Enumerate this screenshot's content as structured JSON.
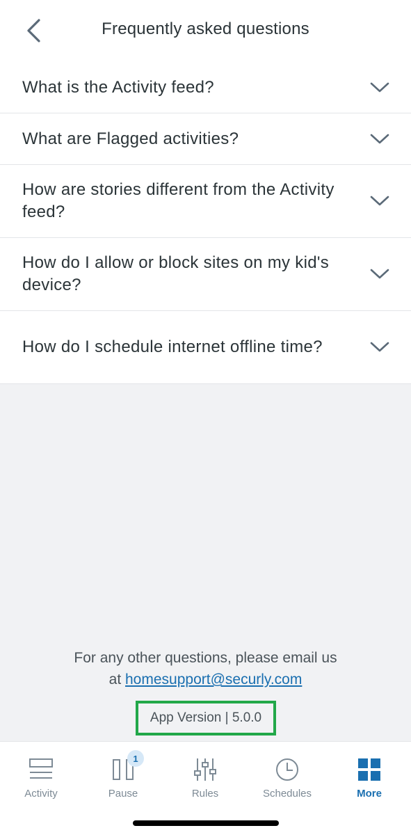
{
  "header": {
    "title": "Frequently asked questions",
    "back_icon": "chevron-left-icon"
  },
  "faq": [
    {
      "question": "What is the Activity feed?"
    },
    {
      "question": "What are Flagged activities?"
    },
    {
      "question": "How are stories different from the Activity feed?"
    },
    {
      "question": "How do I allow or block sites on my kid's device?"
    },
    {
      "question": "How do I schedule internet offline time?"
    }
  ],
  "footer": {
    "text_line1": "For any other questions, please email us",
    "text_at": "at ",
    "email": "homesupport@securly.com",
    "app_version": "App Version | 5.0.0"
  },
  "tabs": [
    {
      "label": "Activity",
      "icon": "activity-icon",
      "active": false
    },
    {
      "label": "Pause",
      "icon": "pause-icon",
      "active": false,
      "badge": "1"
    },
    {
      "label": "Rules",
      "icon": "sliders-icon",
      "active": false
    },
    {
      "label": "Schedules",
      "icon": "clock-icon",
      "active": false
    },
    {
      "label": "More",
      "icon": "grid-icon",
      "active": true
    }
  ],
  "colors": {
    "accent": "#1a6fb0",
    "highlight_box": "#22a849",
    "background": "#f1f2f4",
    "inactive_icon": "#7d8a95"
  }
}
